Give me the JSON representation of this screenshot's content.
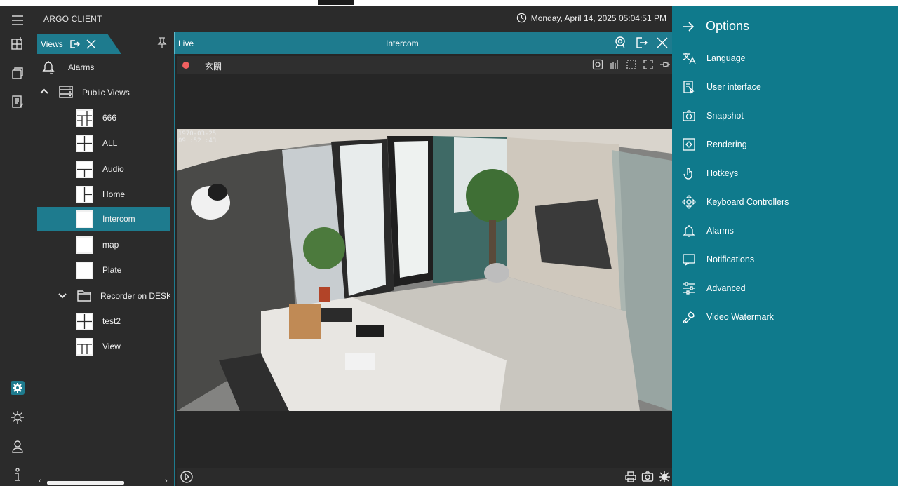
{
  "app": {
    "title": "ARGO CLIENT",
    "datetime": "Monday, April 14, 2025 05:04:51 PM"
  },
  "rail": {
    "items": [
      {
        "name": "menu-icon"
      },
      {
        "name": "views-icon"
      },
      {
        "name": "windows-icon"
      },
      {
        "name": "edit-icon"
      },
      {
        "name": "options-gear-icon",
        "active": true
      },
      {
        "name": "settings-icon"
      },
      {
        "name": "user-icon"
      },
      {
        "name": "info-icon"
      }
    ]
  },
  "views_panel": {
    "tab_label": "Views",
    "tree": [
      {
        "label": "Alarms",
        "type": "alarms",
        "level": 0
      },
      {
        "label": "Public Views",
        "type": "folder-server",
        "level": 0,
        "expanded": true
      },
      {
        "label": "666",
        "type": "view",
        "level": 1
      },
      {
        "label": "ALL",
        "type": "view",
        "level": 1
      },
      {
        "label": "Audio",
        "type": "view",
        "level": 1
      },
      {
        "label": "Home",
        "type": "view",
        "level": 1
      },
      {
        "label": "Intercom",
        "type": "view",
        "level": 1,
        "selected": true
      },
      {
        "label": "map",
        "type": "view",
        "level": 1
      },
      {
        "label": "Plate",
        "type": "view",
        "level": 1
      },
      {
        "label": "Recorder on DESKT",
        "type": "folder",
        "level": 1,
        "expanded": true
      },
      {
        "label": "test2",
        "type": "view",
        "level": 1
      },
      {
        "label": "View",
        "type": "view",
        "level": 1
      }
    ]
  },
  "live": {
    "label": "Live",
    "view_name": "Intercom",
    "camera_name": "玄關",
    "osd_date": "1970-03-25",
    "osd_time": "09 :52 :43",
    "recording": true
  },
  "options": {
    "title": "Options",
    "items": [
      {
        "label": "Language",
        "icon": "language-icon"
      },
      {
        "label": "User interface",
        "icon": "user-interface-icon"
      },
      {
        "label": "Snapshot",
        "icon": "camera-icon"
      },
      {
        "label": "Rendering",
        "icon": "rendering-icon"
      },
      {
        "label": "Hotkeys",
        "icon": "hand-pointer-icon"
      },
      {
        "label": "Keyboard Controllers",
        "icon": "joystick-icon"
      },
      {
        "label": "Alarms",
        "icon": "bell-icon"
      },
      {
        "label": "Notifications",
        "icon": "notification-icon"
      },
      {
        "label": "Advanced",
        "icon": "sliders-icon"
      },
      {
        "label": "Video Watermark",
        "icon": "watermark-icon"
      }
    ]
  },
  "colors": {
    "accent": "#1e7b8e",
    "drawer": "#0f7a8c",
    "panel": "#2b2b2b",
    "record": "#f16060"
  }
}
